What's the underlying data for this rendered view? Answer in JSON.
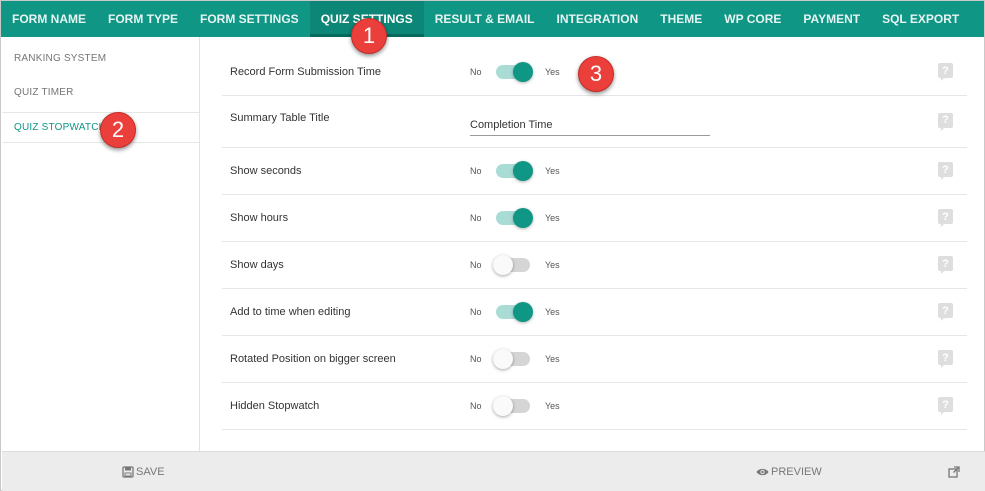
{
  "tabs": [
    {
      "label": "FORM NAME",
      "active": false
    },
    {
      "label": "FORM TYPE",
      "active": false
    },
    {
      "label": "FORM SETTINGS",
      "active": false
    },
    {
      "label": "QUIZ SETTINGS",
      "active": true
    },
    {
      "label": "RESULT & EMAIL",
      "active": false
    },
    {
      "label": "INTEGRATION",
      "active": false
    },
    {
      "label": "THEME",
      "active": false
    },
    {
      "label": "WP CORE",
      "active": false
    },
    {
      "label": "PAYMENT",
      "active": false
    },
    {
      "label": "SQL EXPORT",
      "active": false
    }
  ],
  "sidebar": {
    "items": [
      {
        "label": "RANKING SYSTEM"
      },
      {
        "label": "QUIZ TIMER"
      },
      {
        "label": "QUIZ STOPWATCH",
        "active": true
      }
    ]
  },
  "toggle": {
    "no": "No",
    "yes": "Yes"
  },
  "settings": [
    {
      "label": "Record Form Submission Time",
      "type": "toggle",
      "value": true
    },
    {
      "label": "Summary Table Title",
      "type": "text",
      "value": "Completion Time"
    },
    {
      "label": "Show seconds",
      "type": "toggle",
      "value": true
    },
    {
      "label": "Show hours",
      "type": "toggle",
      "value": true
    },
    {
      "label": "Show days",
      "type": "toggle",
      "value": false
    },
    {
      "label": "Add to time when editing",
      "type": "toggle",
      "value": true
    },
    {
      "label": "Rotated Position on bigger screen",
      "type": "toggle",
      "value": false
    },
    {
      "label": "Hidden Stopwatch",
      "type": "toggle",
      "value": false
    }
  ],
  "help_glyph": "?",
  "footer": {
    "save_label": "SAVE",
    "preview_label": "PREVIEW"
  },
  "annotations": [
    "1",
    "2",
    "3"
  ],
  "colors": {
    "accent": "#0f9685",
    "badge": "#ea3f3a"
  }
}
